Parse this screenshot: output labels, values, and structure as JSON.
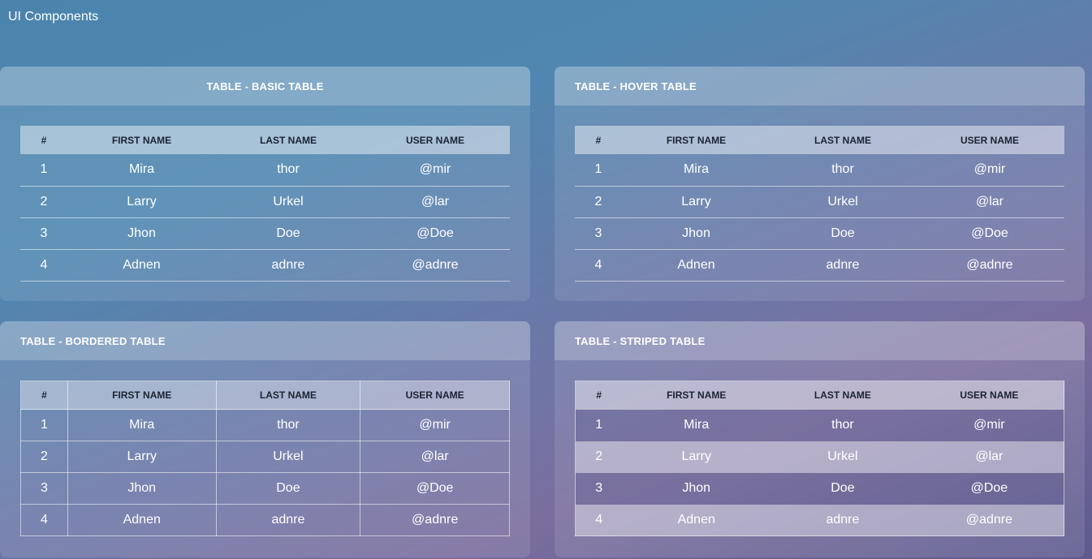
{
  "page": {
    "title": "UI Components"
  },
  "columns": {
    "num": "#",
    "first": "FIRST NAME",
    "last": "LAST NAME",
    "user": "USER NAME"
  },
  "cards": [
    {
      "title": "TABLE - BASIC TABLE"
    },
    {
      "title": "TABLE - HOVER TABLE"
    },
    {
      "title": "TABLE - BORDERED TABLE"
    },
    {
      "title": "TABLE - STRIPED TABLE"
    }
  ],
  "rows": [
    {
      "num": "1",
      "first": "Mira",
      "last": "thor",
      "user": "@mir"
    },
    {
      "num": "2",
      "first": "Larry",
      "last": "Urkel",
      "user": "@lar"
    },
    {
      "num": "3",
      "first": "Jhon",
      "last": "Doe",
      "user": "@Doe"
    },
    {
      "num": "4",
      "first": "Adnen",
      "last": "adnre",
      "user": "@adnre"
    }
  ]
}
